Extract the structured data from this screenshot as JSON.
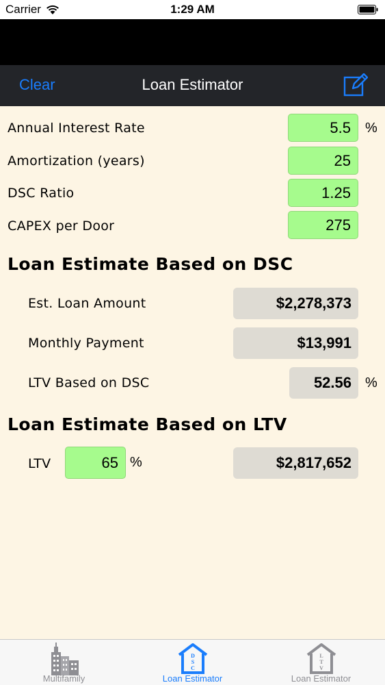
{
  "status_bar": {
    "carrier": "Carrier",
    "time": "1:29 AM"
  },
  "nav": {
    "clear_label": "Clear",
    "title": "Loan Estimator",
    "compose_icon": "compose-icon"
  },
  "inputs": {
    "interest_rate": {
      "label": "Annual Interest Rate",
      "value": "5.5",
      "unit": "%"
    },
    "amortization": {
      "label": "Amortization (years)",
      "value": "25"
    },
    "dsc_ratio": {
      "label": "DSC Ratio",
      "value": "1.25"
    },
    "capex": {
      "label": "CAPEX per Door",
      "value": "275"
    }
  },
  "dsc_section": {
    "title": "Loan Estimate Based on DSC",
    "loan_amount": {
      "label": "Est. Loan Amount",
      "value": "$2,278,373"
    },
    "monthly_payment": {
      "label": "Monthly Payment",
      "value": "$13,991"
    },
    "ltv": {
      "label": "LTV Based on DSC",
      "value": "52.56",
      "unit": "%"
    }
  },
  "ltv_section": {
    "title": "Loan Estimate Based on LTV",
    "ltv_label": "LTV",
    "ltv_value": "65",
    "ltv_unit": "%",
    "loan_amount": "$2,817,652"
  },
  "tabs": [
    {
      "label": "Multifamily",
      "icon": "building-icon",
      "active": false
    },
    {
      "label": "Loan Estimator",
      "icon": "dsc-house-icon",
      "active": true
    },
    {
      "label": "Loan Estimator",
      "icon": "ltv-house-icon",
      "active": false
    }
  ],
  "colors": {
    "accent": "#1a7dfc",
    "input_green": "#a6fb8d",
    "output_gray": "#dedbd3",
    "background": "#fdf5e4",
    "nav_bar": "#232529"
  }
}
